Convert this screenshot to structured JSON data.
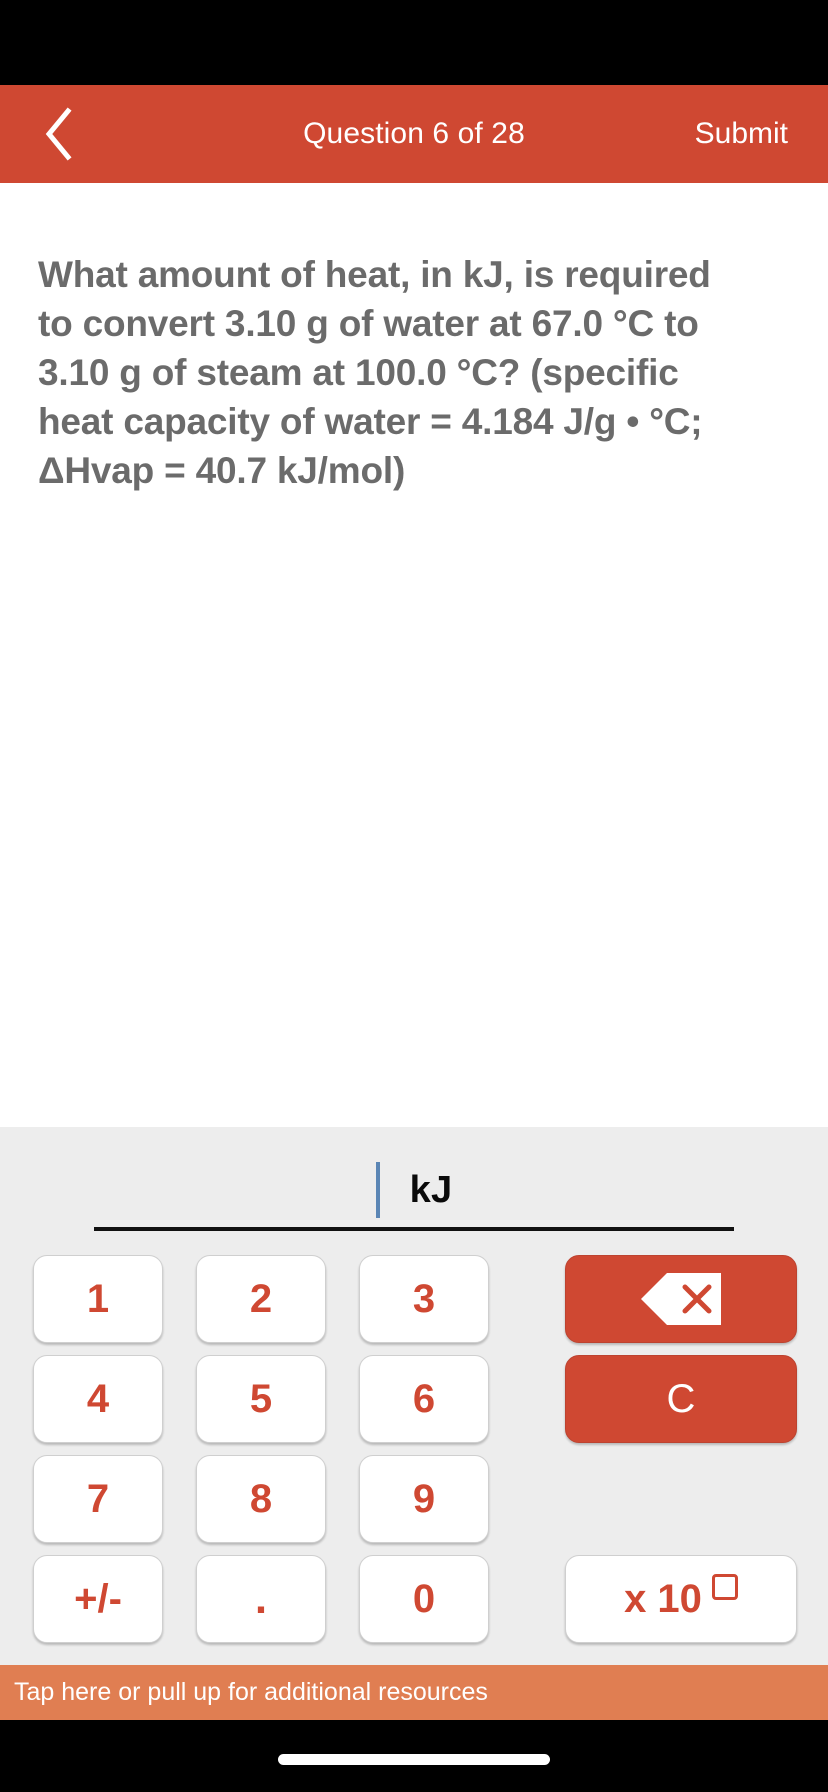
{
  "header": {
    "back_icon": "chevron-left-icon",
    "title": "Question 6 of 28",
    "submit_label": "Submit",
    "bg_color": "#cf4832"
  },
  "question": {
    "text": "What amount of heat, in kJ, is required to convert 3.10 g of water at 67.0 °C to 3.10 g of steam at 100.0 °C? (specific heat capacity of water = 4.184 J/g • °C; ΔHvap = 40.7 kJ/mol)"
  },
  "answer": {
    "value": "",
    "unit": "kJ",
    "caret_color": "#5b86b5"
  },
  "keypad": {
    "rows": [
      {
        "keys": [
          "1",
          "2",
          "3"
        ],
        "action": {
          "type": "backspace",
          "icon": "backspace-icon",
          "label": ""
        }
      },
      {
        "keys": [
          "4",
          "5",
          "6"
        ],
        "action": {
          "type": "clear",
          "icon": "",
          "label": "C"
        }
      },
      {
        "keys": [
          "7",
          "8",
          "9"
        ],
        "action": {
          "type": "none",
          "icon": "",
          "label": ""
        }
      },
      {
        "keys": [
          "+/-",
          ".",
          "0"
        ],
        "action": {
          "type": "exponent",
          "icon": "exponent-box-icon",
          "label": "x 10"
        }
      }
    ],
    "key_color": "#cf4832",
    "panel_bg": "#ededed"
  },
  "resources": {
    "label": "Tap here or pull up for additional resources",
    "bg_color": "#e07e52"
  }
}
